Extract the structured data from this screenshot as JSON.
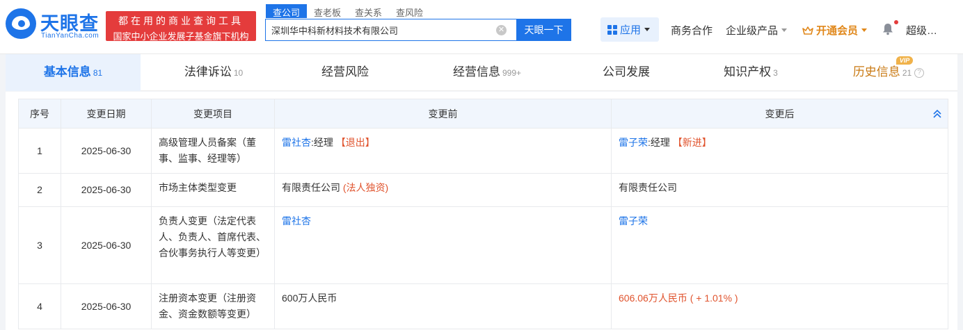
{
  "brand": {
    "name": "天眼查",
    "domain": "TianYanCha.com",
    "slogan_line1": "都在用的商业查询工具",
    "slogan_line2": "国家中小企业发展子基金旗下机构"
  },
  "search": {
    "tabs": [
      "查公司",
      "查老板",
      "查关系",
      "查风险"
    ],
    "active_tab": "查公司",
    "value": "深圳华中科新材料技术有限公司",
    "button": "天眼一下"
  },
  "nav": {
    "apps": "应用",
    "business": "商务合作",
    "enterprise": "企业级产品",
    "vip": "开通会员",
    "user": "超级…"
  },
  "tabs": [
    {
      "label": "基本信息",
      "count": "81"
    },
    {
      "label": "法律诉讼",
      "count": "10"
    },
    {
      "label": "经营风险",
      "count": ""
    },
    {
      "label": "经营信息",
      "count": "999+"
    },
    {
      "label": "公司发展",
      "count": ""
    },
    {
      "label": "知识产权",
      "count": "3"
    },
    {
      "label": "历史信息",
      "count": "21"
    }
  ],
  "vip_badge": "VIP",
  "table": {
    "headers": [
      "序号",
      "变更日期",
      "变更项目",
      "变更前",
      "变更后"
    ],
    "rows": [
      {
        "no": "1",
        "date": "2025-06-30",
        "item": "高级管理人员备案（董事、监事、经理等）",
        "before_name": "雷社杏",
        "before_role": ":经理",
        "before_tag": "【退出】",
        "after_name": "雷子荣",
        "after_role": ":经理",
        "after_tag": "【新进】"
      },
      {
        "no": "2",
        "date": "2025-06-30",
        "item": "市场主体类型变更",
        "before_text": "有限责任公司",
        "before_tag": "(法人独资)",
        "after_text": "有限责任公司"
      },
      {
        "no": "3",
        "date": "2025-06-30",
        "item": "负责人变更（法定代表人、负责人、首席代表、合伙事务执行人等变更）",
        "before_name": "雷社杏",
        "after_name": "雷子荣"
      },
      {
        "no": "4",
        "date": "2025-06-30",
        "item": "注册资本变更（注册资金、资金数额等变更）",
        "before_text": "600万人民币",
        "after_text": "606.06万人民币",
        "after_delta": "( + 1.01% )"
      }
    ]
  },
  "colors": {
    "brand_blue": "#1e74e8",
    "slogan_red": "#e43c3c",
    "history_orange": "#c97a14",
    "change_red": "#e0532d"
  }
}
